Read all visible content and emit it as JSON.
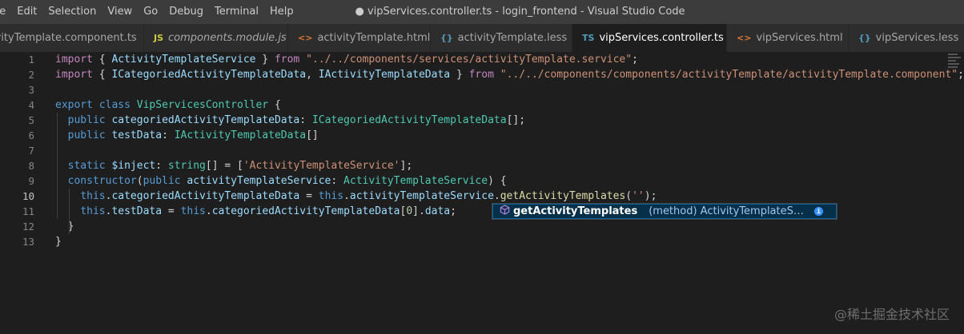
{
  "menu": [
    "ile",
    "Edit",
    "Selection",
    "View",
    "Go",
    "Debug",
    "Terminal",
    "Help"
  ],
  "window_title": "● vipServices.controller.ts - login_frontend - Visual Studio Code",
  "tabs": [
    {
      "icon": "",
      "label": "ivityTemplate.component.ts",
      "italic": false,
      "width": 180
    },
    {
      "icon": "JS",
      "label": "components.module.js",
      "italic": true,
      "width": 180
    },
    {
      "icon": "<>",
      "label": "activityTemplate.html",
      "italic": false,
      "width": 178
    },
    {
      "icon": "{}",
      "label": "activityTemplate.less",
      "italic": false,
      "width": 177
    },
    {
      "icon": "TS",
      "label": "vipServices.controller.ts",
      "italic": false,
      "active": true,
      "dirty": true,
      "width": 193
    },
    {
      "icon": "<>",
      "label": "vipServices.html",
      "italic": false,
      "width": 152
    },
    {
      "icon": "{}",
      "label": "vipServices.less",
      "italic": false,
      "width": 150
    }
  ],
  "line_numbers": [
    "1",
    "2",
    "3",
    "4",
    "5",
    "6",
    "7",
    "8",
    "9",
    "10",
    "11",
    "12",
    "13"
  ],
  "current_line": 10,
  "code_lines": [
    [
      [
        "kw2",
        "import"
      ],
      [
        "pn",
        " { "
      ],
      [
        "var",
        "ActivityTemplateService"
      ],
      [
        "pn",
        " } "
      ],
      [
        "kw2",
        "from"
      ],
      [
        "pn",
        " "
      ],
      [
        "str",
        "\"../../components/services/activityTemplate.service\""
      ],
      [
        "pn",
        ";"
      ]
    ],
    [
      [
        "kw2",
        "import"
      ],
      [
        "pn",
        " { "
      ],
      [
        "var",
        "ICategoriedActivityTemplateData"
      ],
      [
        "pn",
        ", "
      ],
      [
        "var",
        "IActivityTemplateData"
      ],
      [
        "pn",
        " } "
      ],
      [
        "kw2",
        "from"
      ],
      [
        "pn",
        " "
      ],
      [
        "str",
        "\"../../components/components/activityTemplate/activityTemplate.component\""
      ],
      [
        "pn",
        ";"
      ]
    ],
    [],
    [
      [
        "kw",
        "export"
      ],
      [
        "pn",
        " "
      ],
      [
        "kw",
        "class"
      ],
      [
        "pn",
        " "
      ],
      [
        "typ",
        "VipServicesController"
      ],
      [
        "pn",
        " {"
      ]
    ],
    [
      [
        "pn",
        "  "
      ],
      [
        "kw",
        "public"
      ],
      [
        "pn",
        " "
      ],
      [
        "var",
        "categoriedActivityTemplateData"
      ],
      [
        "pn",
        ": "
      ],
      [
        "typ",
        "ICategoriedActivityTemplateData"
      ],
      [
        "pn",
        "[];"
      ]
    ],
    [
      [
        "pn",
        "  "
      ],
      [
        "kw",
        "public"
      ],
      [
        "pn",
        " "
      ],
      [
        "var",
        "testData"
      ],
      [
        "pn",
        ": "
      ],
      [
        "typ",
        "IActivityTemplateData"
      ],
      [
        "pn",
        "[]"
      ]
    ],
    [],
    [
      [
        "pn",
        "  "
      ],
      [
        "kw",
        "static"
      ],
      [
        "pn",
        " "
      ],
      [
        "var",
        "$inject"
      ],
      [
        "pn",
        ": "
      ],
      [
        "typ",
        "string"
      ],
      [
        "pn",
        "[] = ["
      ],
      [
        "str",
        "'ActivityTemplateService'"
      ],
      [
        "pn",
        "];"
      ]
    ],
    [
      [
        "pn",
        "  "
      ],
      [
        "kw",
        "constructor"
      ],
      [
        "pn",
        "("
      ],
      [
        "kw",
        "public"
      ],
      [
        "pn",
        " "
      ],
      [
        "var",
        "activityTemplateService"
      ],
      [
        "pn",
        ": "
      ],
      [
        "typ",
        "ActivityTemplateService"
      ],
      [
        "pn",
        ") {"
      ]
    ],
    [
      [
        "pn",
        "    "
      ],
      [
        "kw",
        "this"
      ],
      [
        "pn",
        "."
      ],
      [
        "var",
        "categoriedActivityTemplateData"
      ],
      [
        "pn",
        " = "
      ],
      [
        "kw",
        "this"
      ],
      [
        "pn",
        "."
      ],
      [
        "var",
        "activityTemplateService"
      ],
      [
        "pn",
        "."
      ],
      [
        "fn",
        "getActivityTemplates"
      ],
      [
        "pn",
        "("
      ],
      [
        "str",
        "''"
      ],
      [
        "pn",
        ");"
      ]
    ],
    [
      [
        "pn",
        "    "
      ],
      [
        "kw",
        "this"
      ],
      [
        "pn",
        "."
      ],
      [
        "var",
        "testData"
      ],
      [
        "pn",
        " = "
      ],
      [
        "kw",
        "this"
      ],
      [
        "pn",
        "."
      ],
      [
        "var",
        "categoriedActivityTemplateData"
      ],
      [
        "pn",
        "["
      ],
      [
        "num",
        "0"
      ],
      [
        "pn",
        "]."
      ],
      [
        "var",
        "data"
      ],
      [
        "pn",
        ";"
      ]
    ],
    [
      [
        "pn",
        "  }"
      ]
    ],
    [
      [
        "pn",
        "}"
      ]
    ]
  ],
  "suggest": {
    "icon": "method-cube-icon",
    "label": "getActivityTemplates",
    "detail": "(method) ActivityTemplateS…",
    "info": "i"
  },
  "watermark": "@稀土掘金技术社区",
  "colors": {
    "titlebar": "#3c3c3c",
    "tabbar": "#252526",
    "editor": "#1e1e1e",
    "keyword": "#569cd6",
    "control_keyword": "#c586c0",
    "string": "#ce9178",
    "type": "#4ec9b0",
    "variable": "#9cdcfe",
    "function": "#dcdcaa"
  }
}
